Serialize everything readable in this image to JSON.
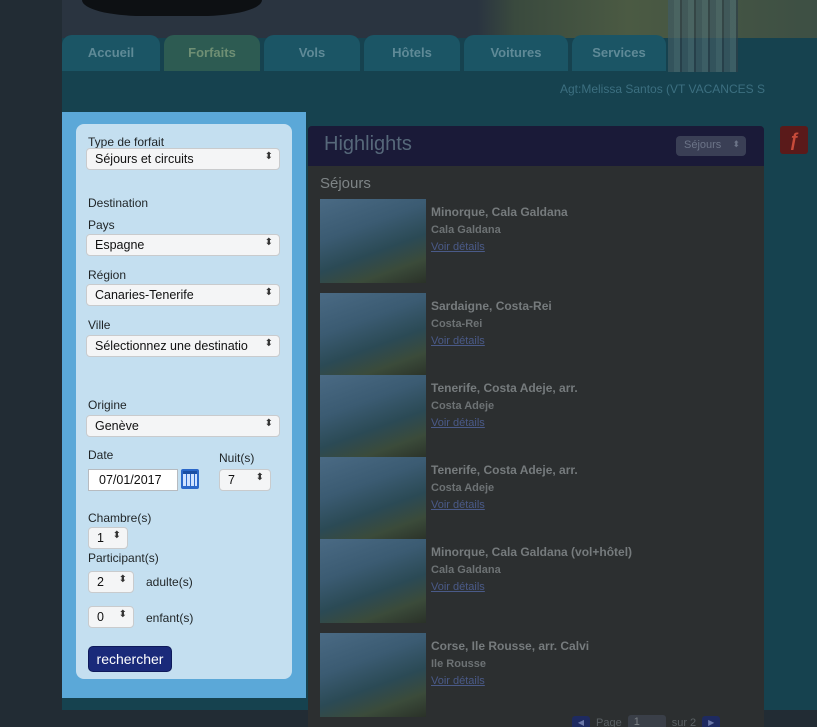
{
  "nav": {
    "tabs": [
      {
        "label": "Accueil"
      },
      {
        "label": "Forfaits"
      },
      {
        "label": "Vols"
      },
      {
        "label": "Hôtels"
      },
      {
        "label": "Voitures"
      },
      {
        "label": "Services"
      }
    ],
    "active_tab": "Forfaits",
    "agent": "Agt:Melissa Santos (VT VACANCES S"
  },
  "search": {
    "type_label": "Type de forfait",
    "type_value": "Séjours et circuits",
    "destination_label": "Destination",
    "country_label": "Pays",
    "country_value": "Espagne",
    "region_label": "Région",
    "region_value": "Canaries-Tenerife",
    "city_label": "Ville",
    "city_value": "Sélectionnez une destinatio",
    "origin_label": "Origine",
    "origin_value": "Genève",
    "date_label": "Date",
    "date_value": "07/01/2017",
    "nights_label": "Nuit(s)",
    "nights_value": "7",
    "rooms_label": "Chambre(s)",
    "rooms_value": "1",
    "participants_label": "Participant(s)",
    "adults_value": "2",
    "adults_label": "adulte(s)",
    "children_value": "0",
    "children_label": "enfant(s)",
    "submit_label": "rechercher",
    "select_arrow": "⬍"
  },
  "highlights": {
    "title": "Highlights",
    "filter_value": "Séjours",
    "section": "Séjours",
    "items": [
      {
        "name": "Minorque, Cala Galdana",
        "sub": "Cala Galdana",
        "link": "Voir détails"
      },
      {
        "name": "Sardaigne, Costa-Rei",
        "sub": "Costa-Rei",
        "link": "Voir détails"
      },
      {
        "name": "Tenerife, Costa Adeje, arr.",
        "sub": "Costa Adeje",
        "link": "Voir détails"
      },
      {
        "name": "Tenerife, Costa Adeje, arr.",
        "sub": "Costa Adeje",
        "link": "Voir détails"
      },
      {
        "name": "Minorque, Cala Galdana (vol+hôtel)",
        "sub": "Cala Galdana",
        "link": "Voir détails"
      },
      {
        "name": "Corse, Ile Rousse, arr. Calvi",
        "sub": "Ile Rousse",
        "link": "Voir détails"
      }
    ],
    "pager": {
      "page_label": "Page",
      "page_value": "1",
      "of_label": "sur 2",
      "prev": "◀",
      "next": "▶"
    }
  },
  "icons": {
    "flash": "flash-plugin-icon",
    "calendar": "calendar-icon"
  }
}
